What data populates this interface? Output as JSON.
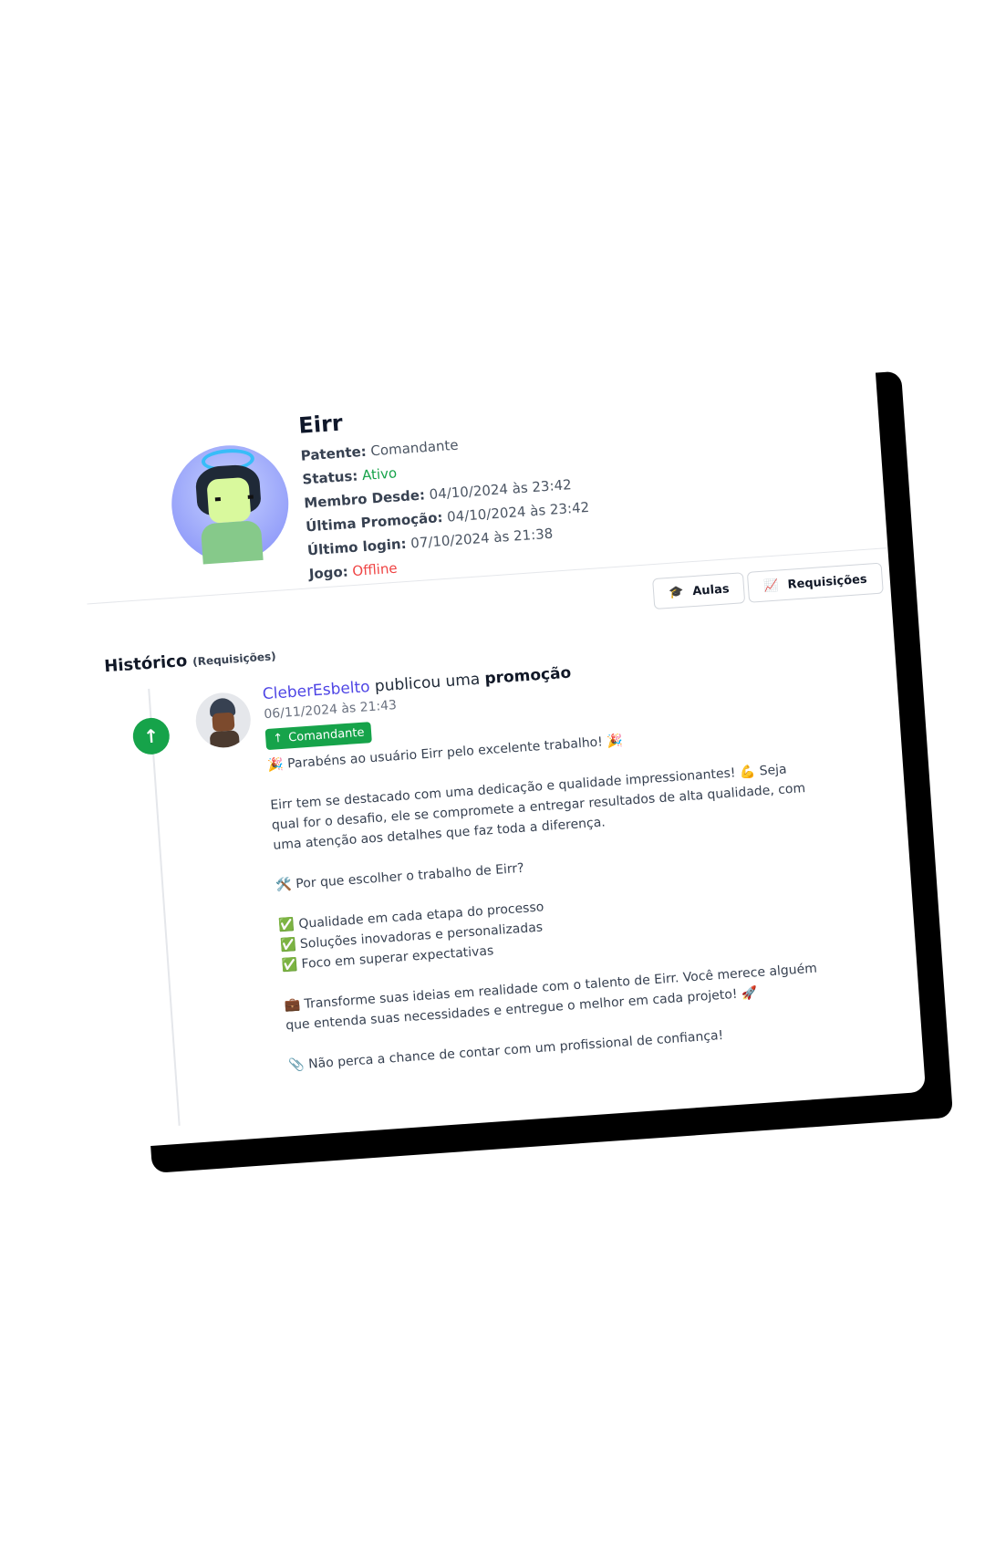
{
  "profile": {
    "name": "Eirr",
    "patente_label": "Patente:",
    "patente": "Comandante",
    "status_label": "Status:",
    "status": "Ativo",
    "membro_label": "Membro Desde:",
    "membro": "04/10/2024 às 23:42",
    "promocao_label": "Última Promoção:",
    "promocao": "04/10/2024 às 23:42",
    "login_label": "Último login:",
    "login": "07/10/2024 às 21:38",
    "jogo_label": "Jogo:",
    "jogo": "Offline"
  },
  "tabs": [
    {
      "label": "Aulas",
      "icon": "graduation-cap-icon"
    },
    {
      "label": "Requisições",
      "icon": "chart-line-icon"
    }
  ],
  "history": {
    "title": "Histórico",
    "subtitle": "(Requisições)",
    "entry": {
      "author": "CleberEsbelto",
      "action": "publicou uma",
      "type": "promoção",
      "date": "06/11/2024 às 21:43",
      "badge": "Comandante",
      "message": "🎉 Parabéns ao usuário Eirr pelo excelente trabalho! 🎉\n\nEirr tem se destacado com uma dedicação e qualidade impressionantes! 💪 Seja qual for o desafio, ele se compromete a entregar resultados de alta qualidade, com uma atenção aos detalhes que faz toda a diferença.\n\n🛠️ Por que escolher o trabalho de Eirr?\n\n✅ Qualidade em cada etapa do processo\n✅ Soluções inovadoras e personalizadas\n✅ Foco em superar expectativas\n\n💼 Transforme suas ideias em realidade com o talento de Eirr. Você merece alguém que entenda suas necessidades e entregue o melhor em cada projeto! 🚀\n\n📎 Não perca a chance de contar com um profissional de confiança!"
    }
  },
  "colors": {
    "accent_green": "#16a34a",
    "offline_red": "#ef4444",
    "author_link": "#4f46e5"
  }
}
